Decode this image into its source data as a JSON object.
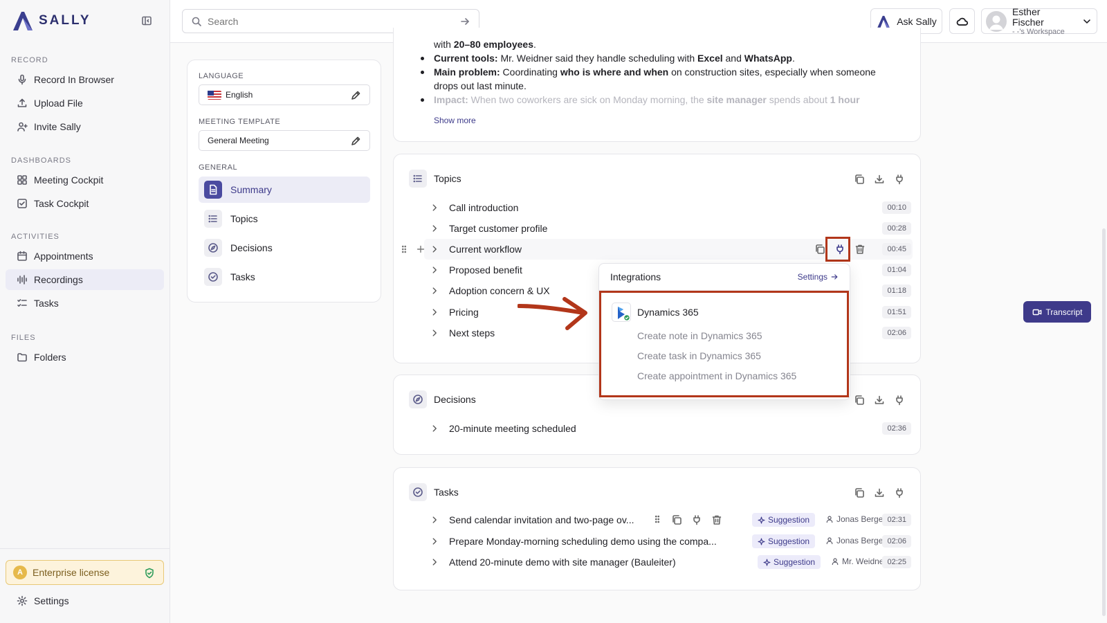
{
  "brand": {
    "name": "SALLY"
  },
  "search": {
    "placeholder": "Search"
  },
  "topbar": {
    "ask_label": "Ask Sally",
    "user_name": "Esther Fischer",
    "user_workspace": "- -'s Workspace"
  },
  "sidebar": {
    "sections": {
      "record": "RECORD",
      "dashboards": "DASHBOARDS",
      "activities": "ACTIVITIES",
      "files": "FILES"
    },
    "items": {
      "record_browser": "Record In Browser",
      "upload": "Upload File",
      "invite": "Invite Sally",
      "meeting_cockpit": "Meeting Cockpit",
      "task_cockpit": "Task Cockpit",
      "appointments": "Appointments",
      "recordings": "Recordings",
      "tasks": "Tasks",
      "folders": "Folders"
    },
    "license": "Enterprise license",
    "settings": "Settings"
  },
  "panel": {
    "language_label": "LANGUAGE",
    "language_value": "English",
    "template_label": "MEETING TEMPLATE",
    "template_value": "General Meeting",
    "general_label": "GENERAL",
    "items": {
      "summary": "Summary",
      "topics": "Topics",
      "decisions": "Decisions",
      "tasks": "Tasks"
    }
  },
  "summary": {
    "line0_pre": "with ",
    "line0_bold": "20–80 employees",
    "line0_post": ".",
    "l1_b": "Current tools:",
    "l1_t1": " Mr. Weidner said they handle scheduling with ",
    "l1_b2": "Excel",
    "l1_t2": " and ",
    "l1_b3": "WhatsApp",
    "l1_t3": ".",
    "l2_b": "Main problem:",
    "l2_t1": " Coordinating ",
    "l2_b2": "who is where and when",
    "l2_t2": " on construction sites, especially when someone",
    "l2_cont": "drops out last minute.",
    "l3_b": "Impact:",
    "l3_t1": " When two coworkers are sick on Monday morning, the ",
    "l3_b2": "site manager",
    "l3_t2": " spends about ",
    "l3_b3": "1 hour",
    "show_more": "Show more"
  },
  "topics": {
    "title": "Topics",
    "rows": [
      {
        "label": "Call introduction",
        "time": "00:10"
      },
      {
        "label": "Target customer profile",
        "time": "00:28"
      },
      {
        "label": "Current workflow",
        "time": "00:45"
      },
      {
        "label": "Proposed benefit",
        "time": "01:04"
      },
      {
        "label": "Adoption concern & UX",
        "time": "01:18"
      },
      {
        "label": "Pricing",
        "time": "01:51"
      },
      {
        "label": "Next steps",
        "time": "02:06"
      }
    ]
  },
  "decisions": {
    "title": "Decisions",
    "rows": [
      {
        "label": "20-minute meeting scheduled",
        "time": "02:36"
      }
    ]
  },
  "tasks": {
    "title": "Tasks",
    "suggestion_label": "Suggestion",
    "rows": [
      {
        "label": "Send calendar invitation and two-page ov...",
        "assignee": "Jonas Berger",
        "time": "02:31"
      },
      {
        "label": "Prepare Monday-morning scheduling demo using the compa...",
        "assignee": "Jonas Berger",
        "time": "02:06"
      },
      {
        "label": "Attend 20-minute demo with site manager (Bauleiter)",
        "assignee": "Mr. Weidner",
        "time": "02:25"
      }
    ]
  },
  "integrations": {
    "title": "Integrations",
    "settings_label": "Settings",
    "provider": "Dynamics 365",
    "actions": [
      "Create note in Dynamics 365",
      "Create task in Dynamics 365",
      "Create appointment in Dynamics 365"
    ]
  },
  "transcript_label": "Transcript",
  "colors": {
    "accent": "#3e3a8a",
    "highlight": "#b2361a",
    "license_bg": "#fdf3dc"
  }
}
